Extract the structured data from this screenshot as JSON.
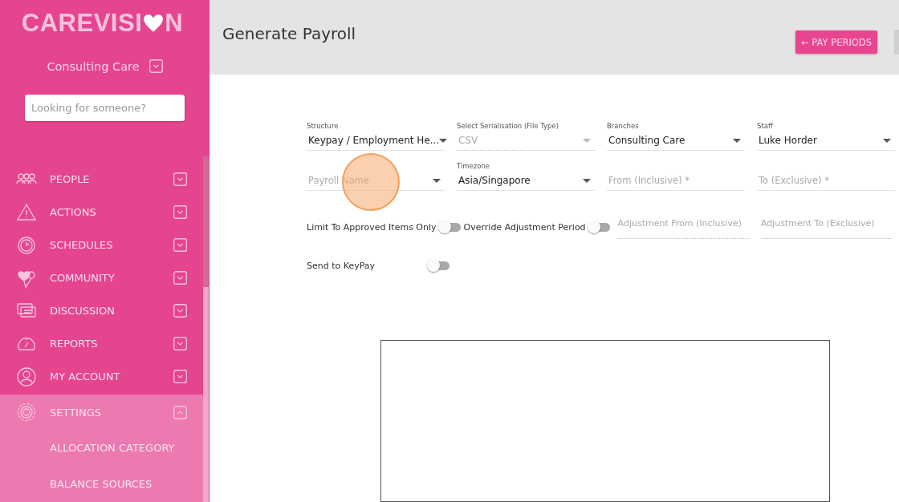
{
  "sidebar": {
    "logo_left": "CAREVISI",
    "logo_right": "N",
    "organisation": {
      "name": "Consulting Care",
      "expanded": false
    },
    "search": {
      "placeholder": "Looking for someone?"
    },
    "items": [
      {
        "label": "PEOPLE",
        "expanded": false
      },
      {
        "label": "ACTIONS",
        "expanded": false
      },
      {
        "label": "SCHEDULES",
        "expanded": false
      },
      {
        "label": "COMMUNITY",
        "expanded": false
      },
      {
        "label": "DISCUSSION",
        "expanded": false
      },
      {
        "label": "REPORTS",
        "expanded": false
      },
      {
        "label": "MY ACCOUNT",
        "expanded": false
      },
      {
        "label": "SETTINGS",
        "expanded": true,
        "children": [
          {
            "label": "ALLOCATION CATEGORY"
          },
          {
            "label": "BALANCE SOURCES"
          }
        ]
      }
    ]
  },
  "header": {
    "title": "Generate Payroll",
    "button": "← PAY PERIODS"
  },
  "form": {
    "rows": [
      [
        {
          "kind": "select",
          "label": "Structure",
          "value": "Keypay / Employment He...",
          "disabled": false
        },
        {
          "kind": "select",
          "label": "Select Serialisation (File Type)",
          "value": "CSV",
          "disabled": true
        },
        {
          "kind": "select",
          "label": "Branches",
          "value": "Consulting Care",
          "disabled": false
        },
        {
          "kind": "select",
          "label": "Staff",
          "value": "Luke Horder",
          "disabled": false
        }
      ],
      [
        {
          "kind": "select",
          "placeholder": "Payroll Name",
          "disabled": false
        },
        {
          "kind": "select",
          "label": "Timezone",
          "value": "Asia/Singapore",
          "disabled": false
        },
        {
          "kind": "input",
          "placeholder": "From (Inclusive) *",
          "disabled": false
        },
        {
          "kind": "input",
          "placeholder": "To (Exclusive) *",
          "disabled": false
        }
      ]
    ],
    "toggles": [
      {
        "label": "Limit To Approved Items Only",
        "on": false
      },
      {
        "label": "Override Adjustment Period",
        "on": false
      }
    ],
    "adjustment_fields": [
      {
        "placeholder": "Adjustment From (Inclusive)",
        "disabled": true
      },
      {
        "placeholder": "Adjustment To (Exclusive)",
        "disabled": true
      }
    ],
    "send_toggle": {
      "label": "Send to KeyPay",
      "on": false
    }
  }
}
